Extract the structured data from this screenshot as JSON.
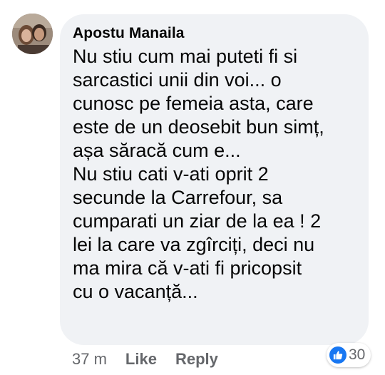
{
  "comment": {
    "author": "Apostu Manaila",
    "lines": [
      "Nu stiu cum mai puteti fi si",
      "sarcastici unii din voi... o",
      "cunosc pe femeia asta, care",
      "este de un deosebit bun simț,",
      "așa săracă cum e...",
      "Nu stiu cati v-ati oprit 2",
      "secunde la Carrefour, sa",
      "cumparati un ziar de la ea ! 2",
      "lei la care va zgîrciți, deci nu",
      "ma mira că v-ati fi pricopsit",
      "cu o vacanță..."
    ]
  },
  "actions": {
    "timestamp": "37 m",
    "like_label": "Like",
    "reply_label": "Reply"
  },
  "reactions": {
    "icon": "thumbs-up-icon",
    "count": "30",
    "color": "#1877f2"
  },
  "colors": {
    "bubble": "#f0f2f5",
    "text": "#050505",
    "secondary_text": "#65676b"
  }
}
